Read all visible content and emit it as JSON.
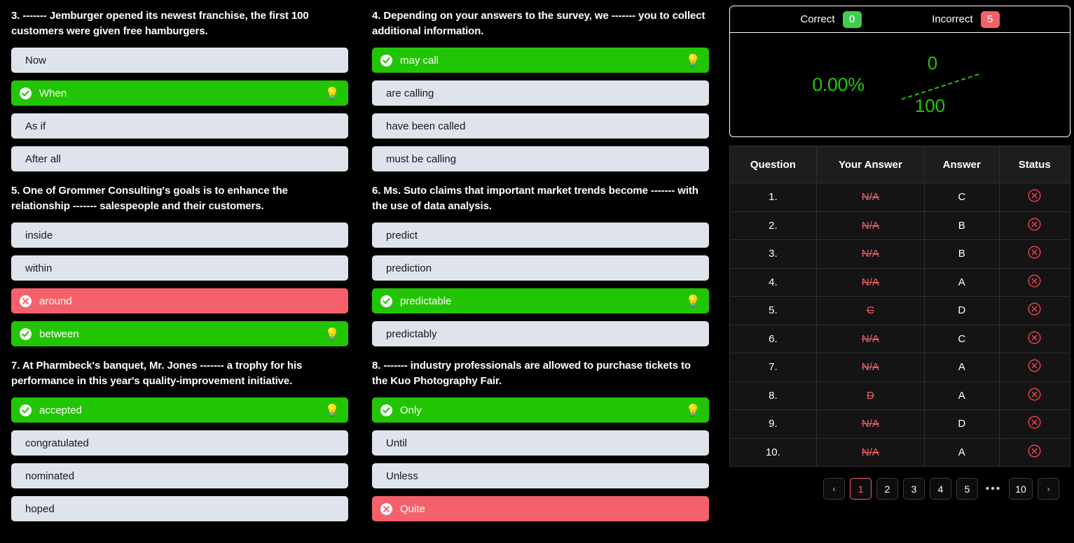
{
  "questions": [
    {
      "number": "3.",
      "text": "3. ------- Jemburger opened its newest franchise, the first 100 customers were given free hamburgers.",
      "options": [
        {
          "label": "Now",
          "state": "neutral"
        },
        {
          "label": "When",
          "state": "correct"
        },
        {
          "label": "As if",
          "state": "neutral"
        },
        {
          "label": "After all",
          "state": "neutral"
        }
      ]
    },
    {
      "number": "4.",
      "text": "4. Depending on your answers to the survey, we ------- you to collect additional information.",
      "options": [
        {
          "label": "may call",
          "state": "correct"
        },
        {
          "label": "are calling",
          "state": "neutral"
        },
        {
          "label": "have been called",
          "state": "neutral"
        },
        {
          "label": "must be calling",
          "state": "neutral"
        }
      ]
    },
    {
      "number": "5.",
      "text": "5. One of Grommer Consulting's goals is to enhance the relationship ------- salespeople and their customers.",
      "options": [
        {
          "label": "inside",
          "state": "neutral"
        },
        {
          "label": "within",
          "state": "neutral"
        },
        {
          "label": "around",
          "state": "incorrect"
        },
        {
          "label": "between",
          "state": "correct"
        }
      ]
    },
    {
      "number": "6.",
      "text": "6. Ms. Suto claims that important market trends become ------- with the use of data analysis.",
      "options": [
        {
          "label": "predict",
          "state": "neutral"
        },
        {
          "label": "prediction",
          "state": "neutral"
        },
        {
          "label": "predictable",
          "state": "correct"
        },
        {
          "label": "predictably",
          "state": "neutral"
        }
      ]
    },
    {
      "number": "7.",
      "text": "7. At Pharmbeck's banquet, Mr. Jones ------- a trophy for his performance in this year's quality-improvement initiative.",
      "options": [
        {
          "label": "accepted",
          "state": "correct"
        },
        {
          "label": "congratulated",
          "state": "neutral"
        },
        {
          "label": "nominated",
          "state": "neutral"
        },
        {
          "label": "hoped",
          "state": "neutral"
        }
      ]
    },
    {
      "number": "8.",
      "text": "8. ------- industry professionals are allowed to purchase tickets to the Kuo Photography Fair.",
      "options": [
        {
          "label": "Only",
          "state": "correct"
        },
        {
          "label": "Until",
          "state": "neutral"
        },
        {
          "label": "Unless",
          "state": "neutral"
        },
        {
          "label": "Quite",
          "state": "incorrect"
        }
      ]
    }
  ],
  "score": {
    "correct_label": "Correct",
    "correct_value": "0",
    "incorrect_label": "Incorrect",
    "incorrect_value": "5",
    "percent": "0.00%",
    "fraction_numerator": "0",
    "fraction_denominator": "100"
  },
  "results": {
    "headers": [
      "Question",
      "Your Answer",
      "Answer",
      "Status"
    ],
    "rows": [
      {
        "question": "1.",
        "your_answer": "N/A",
        "answer": "C",
        "status": "incorrect"
      },
      {
        "question": "2.",
        "your_answer": "N/A",
        "answer": "B",
        "status": "incorrect"
      },
      {
        "question": "3.",
        "your_answer": "N/A",
        "answer": "B",
        "status": "incorrect"
      },
      {
        "question": "4.",
        "your_answer": "N/A",
        "answer": "A",
        "status": "incorrect"
      },
      {
        "question": "5.",
        "your_answer": "C",
        "answer": "D",
        "status": "incorrect"
      },
      {
        "question": "6.",
        "your_answer": "N/A",
        "answer": "C",
        "status": "incorrect"
      },
      {
        "question": "7.",
        "your_answer": "N/A",
        "answer": "A",
        "status": "incorrect"
      },
      {
        "question": "8.",
        "your_answer": "D",
        "answer": "A",
        "status": "incorrect"
      },
      {
        "question": "9.",
        "your_answer": "N/A",
        "answer": "D",
        "status": "incorrect"
      },
      {
        "question": "10.",
        "your_answer": "N/A",
        "answer": "A",
        "status": "incorrect"
      }
    ]
  },
  "pagination": {
    "prev": "‹",
    "next": "›",
    "dots": "•••",
    "pages": [
      "1",
      "2",
      "3",
      "4",
      "5"
    ],
    "last_page": "10",
    "current": "1"
  },
  "icons": {
    "correct_mark": "check-circle-icon",
    "incorrect_mark": "x-circle-icon",
    "hint": "lightbulb-icon",
    "hint_glyph": "💡"
  },
  "colors": {
    "correct_green": "#22c503",
    "incorrect_red": "#f4616b",
    "pill_green": "#41cc50",
    "option_neutral": "#dfe4ec",
    "background": "#000000"
  }
}
